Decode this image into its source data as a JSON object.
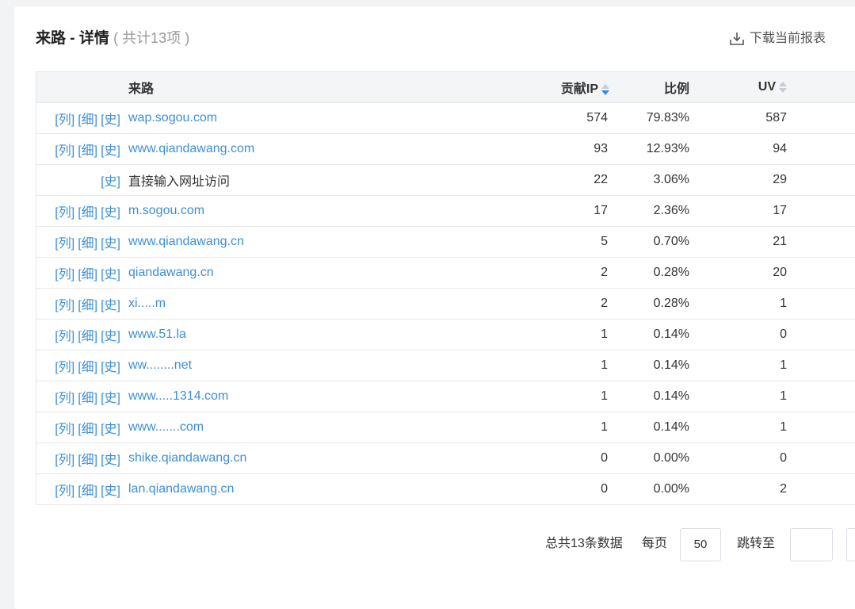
{
  "header": {
    "title": "来路 - 详情",
    "count": "( 共计13项 )",
    "download_label": "下载当前报表"
  },
  "table": {
    "columns": {
      "source": "来路",
      "ip": "贡献IP",
      "ratio": "比例",
      "uv": "UV"
    },
    "action_labels": {
      "list": "[列]",
      "detail": "[细]",
      "history": "[史]"
    },
    "rows": [
      {
        "source": "wap.sogou.com",
        "ip": "574",
        "ratio": "79.83%",
        "uv": "587",
        "is_link": true,
        "actions": [
          "list",
          "detail",
          "history"
        ]
      },
      {
        "source": "www.qiandawang.com",
        "ip": "93",
        "ratio": "12.93%",
        "uv": "94",
        "is_link": true,
        "actions": [
          "list",
          "detail",
          "history"
        ]
      },
      {
        "source": "直接输入网址访问",
        "ip": "22",
        "ratio": "3.06%",
        "uv": "29",
        "is_link": false,
        "actions": [
          "history"
        ]
      },
      {
        "source": "m.sogou.com",
        "ip": "17",
        "ratio": "2.36%",
        "uv": "17",
        "is_link": true,
        "actions": [
          "list",
          "detail",
          "history"
        ]
      },
      {
        "source": "www.qiandawang.cn",
        "ip": "5",
        "ratio": "0.70%",
        "uv": "21",
        "is_link": true,
        "actions": [
          "list",
          "detail",
          "history"
        ]
      },
      {
        "source": "qiandawang.cn",
        "ip": "2",
        "ratio": "0.28%",
        "uv": "20",
        "is_link": true,
        "actions": [
          "list",
          "detail",
          "history"
        ]
      },
      {
        "source": "xi.....m",
        "ip": "2",
        "ratio": "0.28%",
        "uv": "1",
        "is_link": true,
        "actions": [
          "list",
          "detail",
          "history"
        ]
      },
      {
        "source": "www.51.la",
        "ip": "1",
        "ratio": "0.14%",
        "uv": "0",
        "is_link": true,
        "actions": [
          "list",
          "detail",
          "history"
        ]
      },
      {
        "source": "ww........net",
        "ip": "1",
        "ratio": "0.14%",
        "uv": "1",
        "is_link": true,
        "actions": [
          "list",
          "detail",
          "history"
        ]
      },
      {
        "source": "www.....1314.com",
        "ip": "1",
        "ratio": "0.14%",
        "uv": "1",
        "is_link": true,
        "actions": [
          "list",
          "detail",
          "history"
        ]
      },
      {
        "source": "www.......com",
        "ip": "1",
        "ratio": "0.14%",
        "uv": "1",
        "is_link": true,
        "actions": [
          "list",
          "detail",
          "history"
        ]
      },
      {
        "source": "shike.qiandawang.cn",
        "ip": "0",
        "ratio": "0.00%",
        "uv": "0",
        "is_link": true,
        "actions": [
          "list",
          "detail",
          "history"
        ]
      },
      {
        "source": "lan.qiandawang.cn",
        "ip": "0",
        "ratio": "0.00%",
        "uv": "2",
        "is_link": true,
        "actions": [
          "list",
          "detail",
          "history"
        ]
      }
    ]
  },
  "pager": {
    "total_label": "总共13条数据",
    "per_page_label": "每页",
    "page_size": "50",
    "jump_label": "跳转至",
    "jump_value": ""
  },
  "colors": {
    "link": "#3d8fd6",
    "sort_active": "#2d8cf0",
    "header_bg": "#f4f5f7"
  }
}
